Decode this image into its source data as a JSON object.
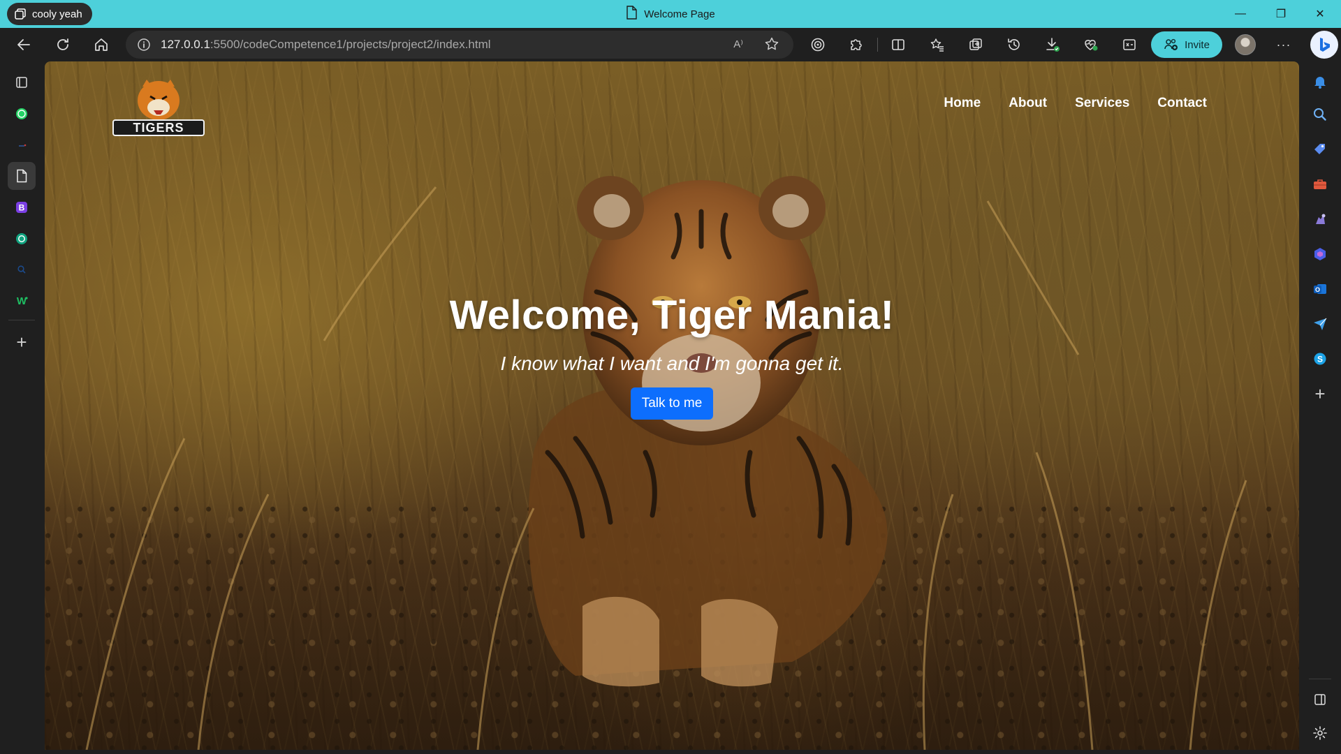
{
  "window": {
    "profile_name": "cooly yeah",
    "tab_title": "Welcome Page",
    "minimize_glyph": "—",
    "restore_glyph": "❐",
    "close_glyph": "✕"
  },
  "toolbar": {
    "url_host": "127.0.0.1",
    "url_rest": ":5500/codeCompetence1/projects/project2/index.html",
    "read_aloud_label": "A⁾",
    "invite_label": "Invite",
    "more_glyph": "···"
  },
  "left_sidebar": {
    "items": [
      "tab-actions-icon",
      "whatsapp-icon",
      "dash-icon",
      "page-icon",
      "bootstrap-icon",
      "chatgpt-icon",
      "search-icon",
      "wix-icon"
    ],
    "add_glyph": "+"
  },
  "right_sidebar": {
    "items": [
      "notifications-icon",
      "search-icon",
      "tag-icon",
      "toolbox-icon",
      "games-icon",
      "copilot-icon",
      "outlook-icon",
      "send-icon",
      "skype-icon"
    ],
    "add_glyph": "+",
    "skype_letter": "S",
    "outlook_letter": "O"
  },
  "page": {
    "logo_text": "TIGERS",
    "nav": [
      "Home",
      "About",
      "Services",
      "Contact"
    ],
    "hero_title": "Welcome, Tiger Mania!",
    "hero_subtitle": "I know what I want and I'm gonna get it.",
    "cta_label": "Talk to me"
  },
  "colors": {
    "titlebar": "#4dd0da",
    "cta": "#0d6efd",
    "chrome": "#1f1f1f"
  }
}
